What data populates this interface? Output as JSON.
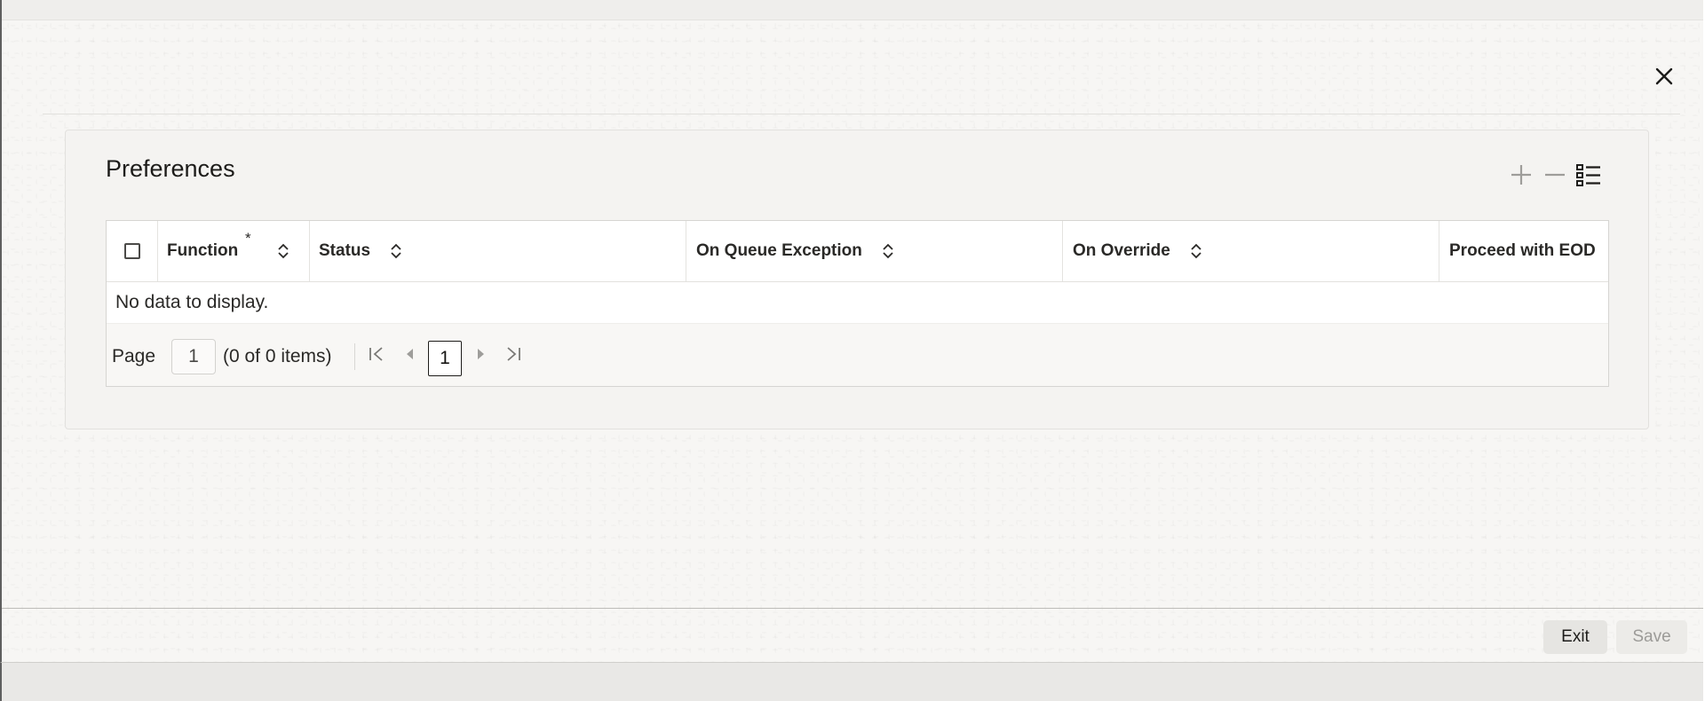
{
  "window": {
    "close_icon": "close-icon"
  },
  "panel": {
    "title": "Preferences",
    "tools": {
      "add_icon": "plus-icon",
      "remove_icon": "minus-icon",
      "columns_icon": "list-settings-icon"
    }
  },
  "grid": {
    "columns": [
      {
        "label": "",
        "type": "select-all-checkbox"
      },
      {
        "label": "Function",
        "required_marker": "*",
        "sortable": true
      },
      {
        "label": "Status",
        "sortable": true
      },
      {
        "label": "On Queue Exception",
        "sortable": true
      },
      {
        "label": "On Override",
        "sortable": true
      },
      {
        "label": "Proceed with EOD",
        "sortable": true
      }
    ],
    "rows": [],
    "empty_message": "No data to display."
  },
  "pager": {
    "page_label": "Page",
    "page_input_value": "1",
    "items_summary": "(0 of 0 items)",
    "current_page": "1",
    "nav_icons": [
      "first-page-icon",
      "previous-page-icon",
      "next-page-icon",
      "last-page-icon"
    ]
  },
  "footer": {
    "exit_label": "Exit",
    "save_label": "Save",
    "save_enabled": false
  },
  "colors": {
    "background": "#f7f6f4",
    "panel": "#f4f3f1",
    "text": "#161513",
    "border": "#d6d5d2",
    "disabled_text": "#9c9b98"
  }
}
